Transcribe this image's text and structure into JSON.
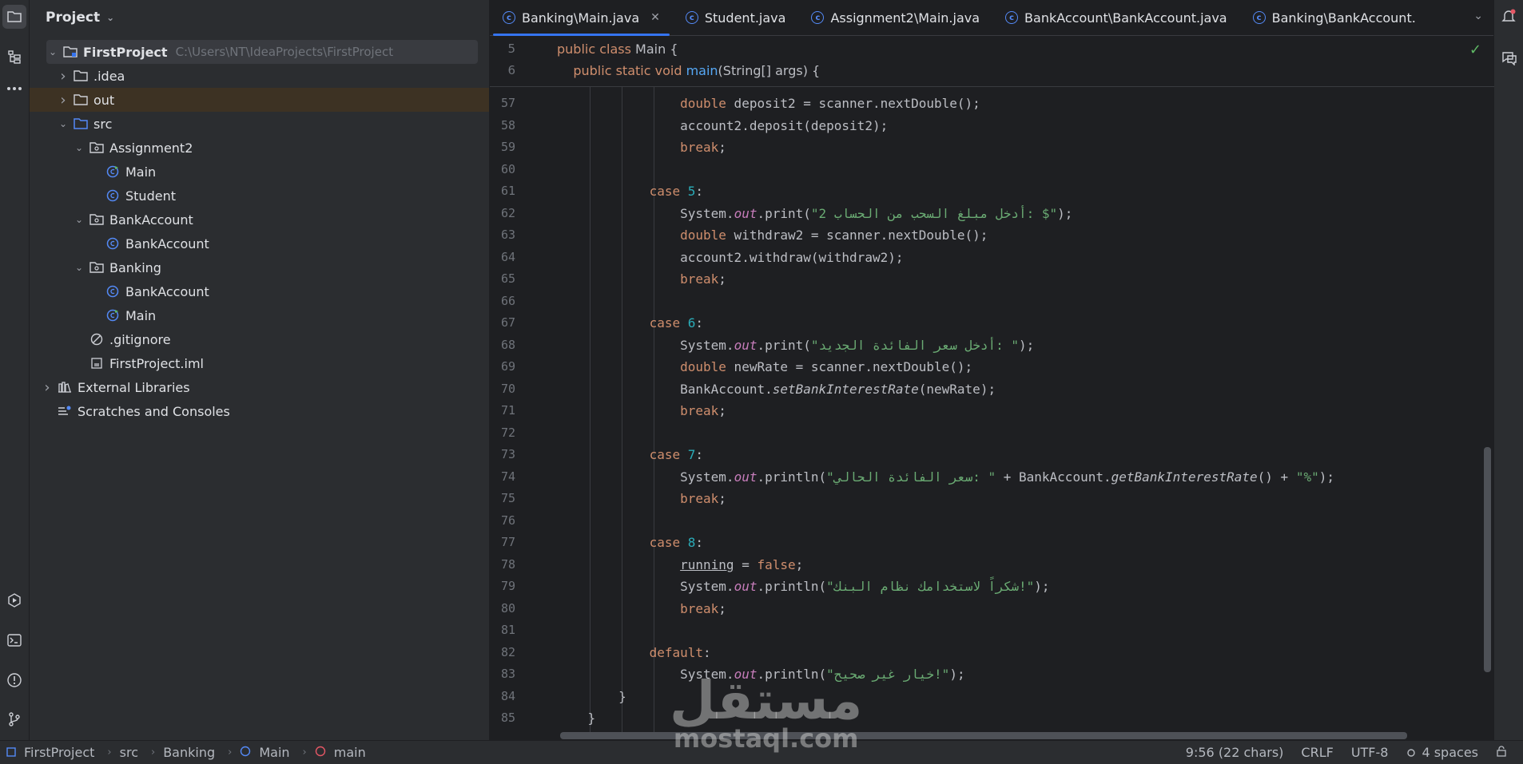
{
  "leftbar": {
    "icons": [
      "folder-icon",
      "structure-icon",
      "more-icon",
      "run-icon",
      "terminal-icon",
      "problems-icon",
      "git-icon"
    ]
  },
  "project": {
    "title": "Project",
    "tree": [
      {
        "label": "FirstProject",
        "path": "C:\\Users\\NT\\IdeaProjects\\FirstProject",
        "depth": 0,
        "arrow": "open",
        "icon": "module-folder-icon",
        "selected": true
      },
      {
        "label": ".idea",
        "depth": 1,
        "arrow": "closed",
        "icon": "folder-icon"
      },
      {
        "label": "out",
        "depth": 1,
        "arrow": "closed",
        "icon": "folder-icon",
        "highlight": true
      },
      {
        "label": "src",
        "depth": 1,
        "arrow": "open",
        "icon": "source-folder-icon"
      },
      {
        "label": "Assignment2",
        "depth": 2,
        "arrow": "open",
        "icon": "package-icon"
      },
      {
        "label": "Main",
        "depth": 3,
        "icon": "runnable-class-icon"
      },
      {
        "label": "Student",
        "depth": 3,
        "icon": "class-icon"
      },
      {
        "label": "BankAccount",
        "depth": 2,
        "arrow": "open",
        "icon": "package-icon"
      },
      {
        "label": "BankAccount",
        "depth": 3,
        "icon": "class-icon"
      },
      {
        "label": "Banking",
        "depth": 2,
        "arrow": "open",
        "icon": "package-icon"
      },
      {
        "label": "BankAccount",
        "depth": 3,
        "icon": "class-icon"
      },
      {
        "label": "Main",
        "depth": 3,
        "icon": "runnable-class-icon"
      },
      {
        "label": ".gitignore",
        "depth": 2,
        "icon": "ignore-file-icon"
      },
      {
        "label": "FirstProject.iml",
        "depth": 2,
        "icon": "iml-file-icon"
      },
      {
        "label": "External Libraries",
        "depth": 0,
        "arrow": "closed",
        "icon": "library-icon"
      },
      {
        "label": "Scratches and Consoles",
        "depth": 0,
        "icon": "scratches-icon"
      }
    ]
  },
  "tabs": [
    {
      "label": "Banking\\Main.java",
      "active": true,
      "closable": true
    },
    {
      "label": "Student.java"
    },
    {
      "label": "Assignment2\\Main.java"
    },
    {
      "label": "BankAccount\\BankAccount.java"
    },
    {
      "label": "Banking\\BankAccount."
    }
  ],
  "sticky": [
    {
      "ln": "5",
      "code": "public class Main {"
    },
    {
      "ln": "6",
      "code": "    public static void main(String[] args) {"
    }
  ],
  "code_lines": [
    {
      "ln": "57",
      "code": "                double deposit2 = scanner.nextDouble();"
    },
    {
      "ln": "58",
      "code": "                account2.deposit(deposit2);"
    },
    {
      "ln": "59",
      "code": "                break;"
    },
    {
      "ln": "60",
      "code": ""
    },
    {
      "ln": "61",
      "code": "            case 5:"
    },
    {
      "ln": "62",
      "code": "                System.out.print(\"أدخل مبلغ السحب من الحساب 2: $\");"
    },
    {
      "ln": "63",
      "code": "                double withdraw2 = scanner.nextDouble();"
    },
    {
      "ln": "64",
      "code": "                account2.withdraw(withdraw2);"
    },
    {
      "ln": "65",
      "code": "                break;"
    },
    {
      "ln": "66",
      "code": ""
    },
    {
      "ln": "67",
      "code": "            case 6:"
    },
    {
      "ln": "68",
      "code": "                System.out.print(\"أدخل سعر الفائدة الجديد: \");"
    },
    {
      "ln": "69",
      "code": "                double newRate = scanner.nextDouble();"
    },
    {
      "ln": "70",
      "code": "                BankAccount.setBankInterestRate(newRate);"
    },
    {
      "ln": "71",
      "code": "                break;"
    },
    {
      "ln": "72",
      "code": ""
    },
    {
      "ln": "73",
      "code": "            case 7:"
    },
    {
      "ln": "74",
      "code": "                System.out.println(\"سعر الفائدة الحالي: \" + BankAccount.getBankInterestRate() + \"%\");"
    },
    {
      "ln": "75",
      "code": "                break;"
    },
    {
      "ln": "76",
      "code": ""
    },
    {
      "ln": "77",
      "code": "            case 8:"
    },
    {
      "ln": "78",
      "code": "                running = false;"
    },
    {
      "ln": "79",
      "code": "                System.out.println(\"شكراً لاستخدامك نظام البنك!\");"
    },
    {
      "ln": "80",
      "code": "                break;"
    },
    {
      "ln": "81",
      "code": ""
    },
    {
      "ln": "82",
      "code": "            default:"
    },
    {
      "ln": "83",
      "code": "                System.out.println(\"خيار غير صحيح!\");"
    },
    {
      "ln": "84",
      "code": "        }"
    },
    {
      "ln": "85",
      "code": "    }"
    }
  ],
  "status": {
    "breadcrumb": [
      "FirstProject",
      "src",
      "Banking",
      "Main",
      "main"
    ],
    "position": "9:56 (22 chars)",
    "line_sep": "CRLF",
    "encoding": "UTF-8",
    "indent": "4 spaces"
  },
  "watermark": {
    "arabic": "مستقل",
    "latin": "mostaql.com"
  },
  "colors": {
    "accent": "#3574f0",
    "keyword": "#cf8e6d",
    "string": "#6aab73",
    "number": "#2aacb8",
    "field": "#c77dbb",
    "method": "#56a8f5"
  }
}
